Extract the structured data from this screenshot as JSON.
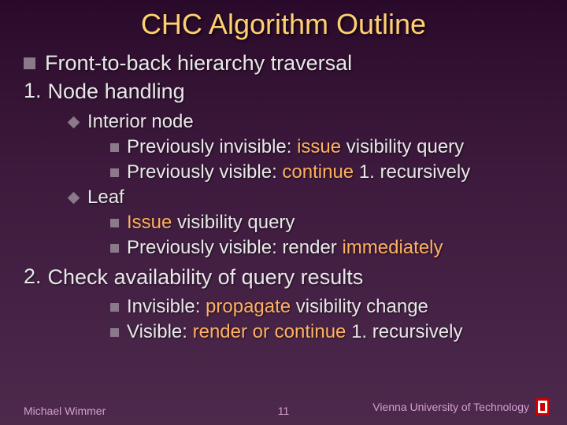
{
  "title": "CHC Algorithm Outline",
  "line_front": "Front-to-back hierarchy traversal",
  "num1": "1.",
  "step1": "Node handling",
  "interior": "Interior node",
  "int_a": "Previously invisible: ",
  "int_a_hl": "issue",
  "int_a_end": " visibility query",
  "int_b": "Previously visible: ",
  "int_b_hl": "continue",
  "int_b_end": " 1. recursively",
  "leaf": "Leaf",
  "leaf_a_hl": "Issue",
  "leaf_a_end": " visibility query",
  "leaf_b": "Previously visible: render ",
  "leaf_b_hl": "immediately",
  "num2": "2.",
  "step2": "Check availability of query results",
  "res_a": "Invisible: ",
  "res_a_hl": "propagate",
  "res_a_end": " visibility change",
  "res_b": "Visible: ",
  "res_b_hl": "render or continue",
  "res_b_end": " 1. recursively",
  "footer_left": "Michael Wimmer",
  "footer_center": "11",
  "footer_right": "Vienna University of Technology"
}
